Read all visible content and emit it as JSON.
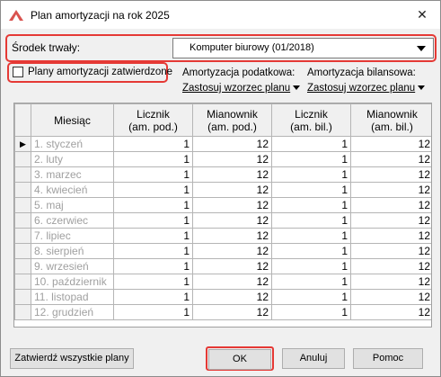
{
  "window": {
    "title": "Plan amortyzacji na rok 2025",
    "close_glyph": "✕"
  },
  "asset": {
    "label": "Środek trwały:",
    "selected": "Komputer biurowy (01/2018)"
  },
  "approved": {
    "label": "Plany amortyzacji zatwierdzone",
    "checked": false
  },
  "tax": {
    "label": "Amortyzacja podatkowa:",
    "link": "Zastosuj wzorzec planu"
  },
  "balance": {
    "label": "Amortyzacja bilansowa:",
    "link": "Zastosuj wzorzec planu"
  },
  "table": {
    "headers": {
      "month": "Miesiąc",
      "num_tax": "Licznik (am. pod.)",
      "den_tax": "Mianownik (am. pod.)",
      "num_bal": "Licznik (am. bil.)",
      "den_bal": "Mianownik (am. bil.)"
    },
    "current_row_marker": "▶",
    "rows": [
      {
        "month": "1. styczeń",
        "num_tax": "1",
        "den_tax": "12",
        "num_bal": "1",
        "den_bal": "12"
      },
      {
        "month": "2. luty",
        "num_tax": "1",
        "den_tax": "12",
        "num_bal": "1",
        "den_bal": "12"
      },
      {
        "month": "3. marzec",
        "num_tax": "1",
        "den_tax": "12",
        "num_bal": "1",
        "den_bal": "12"
      },
      {
        "month": "4. kwiecień",
        "num_tax": "1",
        "den_tax": "12",
        "num_bal": "1",
        "den_bal": "12"
      },
      {
        "month": "5. maj",
        "num_tax": "1",
        "den_tax": "12",
        "num_bal": "1",
        "den_bal": "12"
      },
      {
        "month": "6. czerwiec",
        "num_tax": "1",
        "den_tax": "12",
        "num_bal": "1",
        "den_bal": "12"
      },
      {
        "month": "7. lipiec",
        "num_tax": "1",
        "den_tax": "12",
        "num_bal": "1",
        "den_bal": "12"
      },
      {
        "month": "8. sierpień",
        "num_tax": "1",
        "den_tax": "12",
        "num_bal": "1",
        "den_bal": "12"
      },
      {
        "month": "9. wrzesień",
        "num_tax": "1",
        "den_tax": "12",
        "num_bal": "1",
        "den_bal": "12"
      },
      {
        "month": "10. październik",
        "num_tax": "1",
        "den_tax": "12",
        "num_bal": "1",
        "den_bal": "12"
      },
      {
        "month": "11. listopad",
        "num_tax": "1",
        "den_tax": "12",
        "num_bal": "1",
        "den_bal": "12"
      },
      {
        "month": "12. grudzień",
        "num_tax": "1",
        "den_tax": "12",
        "num_bal": "1",
        "den_bal": "12"
      }
    ]
  },
  "buttons": {
    "approve_all": "Zatwierdź wszystkie plany",
    "ok": "OK",
    "cancel": "Anuluj",
    "help": "Pomoc"
  },
  "colors": {
    "highlight": "#e53935",
    "month_text": "#a0a0a0"
  }
}
